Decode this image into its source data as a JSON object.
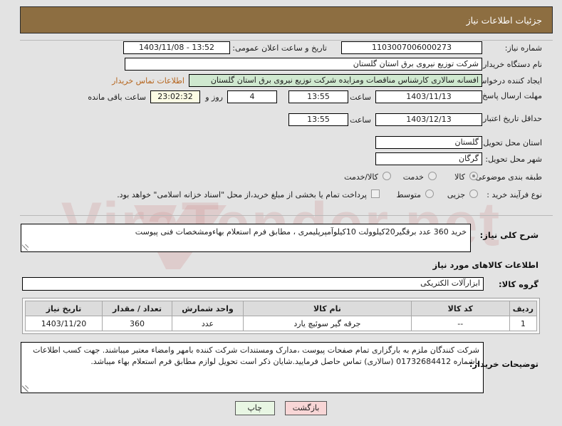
{
  "header": {
    "title": "جزئیات اطلاعات نیاز"
  },
  "form": {
    "need_number_label": "شماره نیاز:",
    "need_number_value": "1103007006000273",
    "announce_label": "تاریخ و ساعت اعلان عمومی:",
    "announce_value": "13:52 - 1403/11/08",
    "buyer_org_label": "نام دستگاه خریدار:",
    "buyer_org_value": "شرکت توزیع نیروی برق استان گلستان",
    "creator_label": "ایجاد کننده درخواست:",
    "creator_value": "افسانه سالاری کارشناس مناقصات ومزایده شرکت توزیع نیروی برق استان گلستان",
    "contact_link": "اطلاعات تماس خریدار",
    "deadline_label": "مهلت ارسال پاسخ: تا تاریخ:",
    "deadline_date": "1403/11/13",
    "hour_label": "ساعت",
    "deadline_time": "13:55",
    "days_remaining": "4",
    "day_and_label": "روز و",
    "countdown_value": "23:02:32",
    "countdown_label": "ساعت باقی مانده",
    "price_validity_label": "حداقل تاریخ اعتبار قیمت: تا تاریخ:",
    "price_validity_date": "1403/12/13",
    "price_validity_time": "13:55",
    "province_label": "استان محل تحویل:",
    "province_value": "گلستان",
    "city_label": "شهر محل تحویل:",
    "city_value": "گرگان",
    "category_label": "طبقه بندی موضوعی:",
    "category_options": [
      "کالا",
      "خدمت",
      "کالا/خدمت"
    ],
    "category_selected": "کالا",
    "process_label": "نوع فرآیند خرید :",
    "process_options": [
      "جزیی",
      "متوسط"
    ],
    "treasury_note": "پرداخت تمام یا بخشی از مبلغ خرید،از محل \"اسناد خزانه اسلامی\" خواهد بود.",
    "description_label": "شرح کلی نیاز:",
    "description_value": "خرید 360 عدد برقگیر20کیلوولت 10کیلوآمپرپلیمری ، مطابق فرم استعلام بهاءومشخصات فنی پیوست",
    "goods_section_title": "اطلاعات کالاهای مورد نیاز",
    "goods_group_label": "گروه کالا:",
    "goods_group_value": "ابزارآلات الکتریکی",
    "buyer_notes_label": "توضیحات خریدار:",
    "buyer_notes_value": "شرکت کنندگان ملزم به بارگزاری تمام صفحات پیوست ،مدارک ومستندات شرکت کننده بامهر وامضاء معتبر میباشند. جهت کسب اطلاعات باشماره 01732684412 (سالاری) تماس حاصل فرمایید.شایان ذکر است تحویل لوازم مطابق فرم استعلام بهاء میباشد."
  },
  "table": {
    "headers": [
      "ردیف",
      "کد کالا",
      "نام کالا",
      "واحد شمارش",
      "تعداد / مقدار",
      "تاریخ نیاز"
    ],
    "rows": [
      {
        "index": "1",
        "code": "--",
        "name": "جرقه گیر سوئیچ یارد",
        "unit": "عدد",
        "qty": "360",
        "need_date": "1403/11/20"
      }
    ]
  },
  "buttons": {
    "print": "چاپ",
    "back": "بازگشت"
  },
  "watermark": {
    "text": "ViraTender.net"
  },
  "colors": {
    "header_bg": "#8d6e41",
    "link": "#b5651d",
    "print_btn": "#e8f6e3",
    "back_btn": "#f8d6d6"
  }
}
